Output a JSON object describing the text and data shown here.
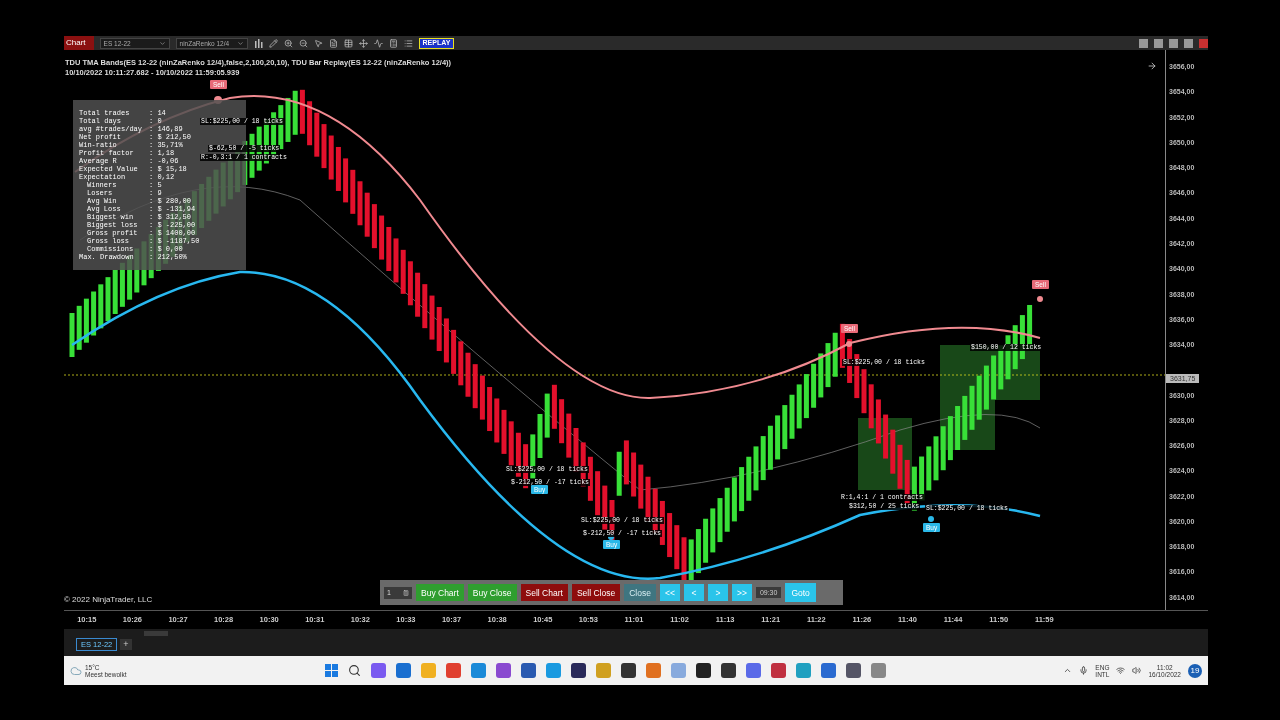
{
  "toolbar": {
    "chart_tab": "Chart",
    "instrument": "ES 12-22",
    "bar_type": "ninZaRenko 12/4",
    "replay_button": "REPLAY"
  },
  "chart": {
    "indicator_line": "TDU TMA Bands(ES 12-22 (ninZaRenko 12/4),false,2,100,20,10), TDU Bar Replay(ES 12-22 (ninZaRenko 12/4))",
    "date_range": "10/10/2022 10:11:27.682 - 10/10/2022 11:59:05.939",
    "copyright": "© 2022 NinjaTrader, LLC",
    "price_marker": "3631,75"
  },
  "stats": [
    {
      "label": "Total trades",
      "value": ": 14"
    },
    {
      "label": "Total days",
      "value": ": 0"
    },
    {
      "label": "avg #trades/day",
      "value": ": 146,89"
    },
    {
      "label": "Net profit",
      "value": ": $ 212,50"
    },
    {
      "label": "Win-ratio",
      "value": ": 35,71%"
    },
    {
      "label": "Profit factor",
      "value": ": 1,18"
    },
    {
      "label": "Average R",
      "value": ": -0,06"
    },
    {
      "label": "Expected Value",
      "value": ": $ 15,18"
    },
    {
      "label": "Expectation",
      "value": ": 0,12",
      "children": [
        {
          "label": "Winners",
          "value": ": 5"
        },
        {
          "label": "Losers",
          "value": ": 9"
        },
        {
          "label": "Avg Win",
          "value": ": $ 280,00"
        },
        {
          "label": "Avg Loss",
          "value": ": $ -131,94"
        },
        {
          "label": "Biggest win",
          "value": ": $ 312,50"
        },
        {
          "label": "Biggest loss",
          "value": ": $ -225,00"
        },
        {
          "label": "Gross profit",
          "value": ": $ 1400,00"
        },
        {
          "label": "Gross loss",
          "value": ": $ -1187,50"
        },
        {
          "label": "Commissions",
          "value": ": $ 0,00"
        }
      ]
    },
    {
      "label": "Max. Drawdown",
      "value": ": 212,50%"
    }
  ],
  "markers": [
    {
      "kind": "sell",
      "label": "Sell"
    },
    {
      "kind": "sell",
      "label": "Sell"
    },
    {
      "kind": "sell",
      "label": "Sell"
    },
    {
      "kind": "buy",
      "label": "Buy"
    },
    {
      "kind": "buy",
      "label": "Buy"
    },
    {
      "kind": "buy",
      "label": "Buy"
    }
  ],
  "annotations": [
    "SL:$225,00 / 18 ticks",
    "$-62,50 / -5 ticks",
    "R:-0,3:1 / 1 contracts",
    "SL:$225,00 / 18 ticks",
    "$-212,50 / -17 ticks",
    "SL:$225,00 / 18 ticks",
    "$-212,50 / -17 ticks",
    "SL:$225,00 / 18 ticks",
    "$150,00 / 12 ticks",
    "R:1,4:1 / 1 contracts",
    "$312,50 / 25 ticks",
    "SL:$225,00 / 18 ticks"
  ],
  "replay_bar": {
    "quantity": "1",
    "buttons": [
      {
        "label": "Buy Chart",
        "kind": "buy",
        "disabled": false
      },
      {
        "label": "Buy Close",
        "kind": "buy",
        "disabled": false
      },
      {
        "label": "Sell Chart",
        "kind": "sell",
        "disabled": false
      },
      {
        "label": "Sell Close",
        "kind": "sell",
        "disabled": false
      },
      {
        "label": "Close",
        "kind": "close",
        "disabled": true
      },
      {
        "label": "<<",
        "kind": "nav",
        "disabled": false
      },
      {
        "label": "<",
        "kind": "nav",
        "disabled": false
      },
      {
        "label": ">",
        "kind": "nav",
        "disabled": false
      },
      {
        "label": ">>",
        "kind": "nav",
        "disabled": false
      }
    ],
    "time": "09:30",
    "goto": "Goto"
  },
  "price_axis": {
    "upper": [
      "3656,00",
      "3654,00",
      "3652,00",
      "3650,00",
      "3648,00",
      "3646,00",
      "3644,00",
      "3642,00",
      "3640,00",
      "3638,00",
      "3636,00",
      "3634,00"
    ],
    "lower": [
      "3630,00",
      "3628,00",
      "3626,00",
      "3624,00",
      "3622,00",
      "3620,00",
      "3618,00",
      "3616,00",
      "3614,00"
    ]
  },
  "time_axis": [
    "10:15",
    "10:26",
    "10:27",
    "10:28",
    "10:30",
    "10:31",
    "10:32",
    "10:33",
    "10:37",
    "10:38",
    "10:45",
    "10:53",
    "11:01",
    "11:02",
    "11:13",
    "11:21",
    "11:22",
    "11:26",
    "11:40",
    "11:44",
    "11:50",
    "11:59"
  ],
  "tabs": [
    {
      "label": "ES 12-22",
      "selected": true
    }
  ],
  "add_tab": "+",
  "taskbar": {
    "temperature": "15°C",
    "weather": "Meest bewolkt",
    "language": "ENG",
    "layout": "INTL",
    "time": "11:02",
    "date": "16/10/2022",
    "notifications": "19"
  }
}
